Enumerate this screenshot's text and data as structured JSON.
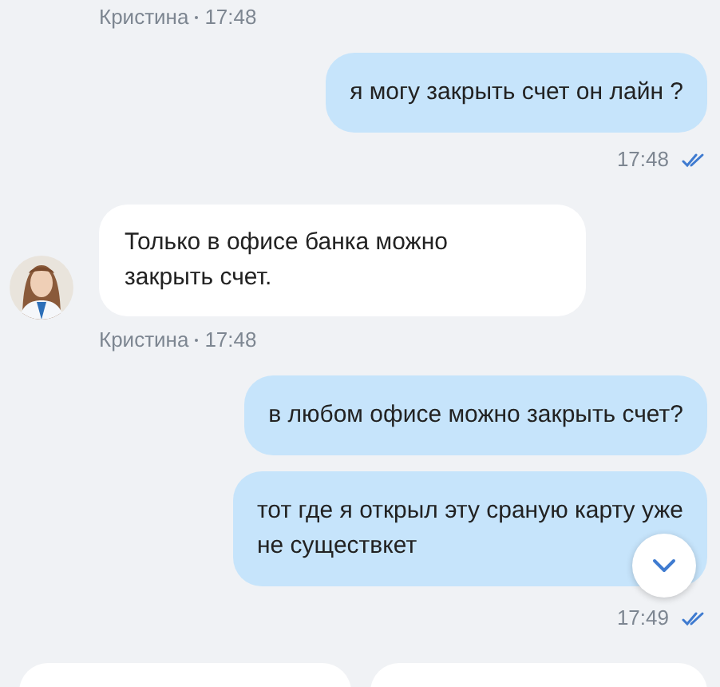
{
  "messages": [
    {
      "kind": "sender",
      "name": "Кристина",
      "time": "17:48"
    },
    {
      "kind": "outgoing",
      "lines": [
        "я могу закрыть счет он лайн ?"
      ]
    },
    {
      "kind": "time",
      "time": "17:48",
      "read": true
    },
    {
      "kind": "incoming",
      "lines": [
        "Только в офисе банка можно",
        "закрыть счет."
      ]
    },
    {
      "kind": "sender",
      "name": "Кристина",
      "time": "17:48"
    },
    {
      "kind": "outgoing",
      "lines": [
        "в любом офисе можно закрыть счет?"
      ]
    },
    {
      "kind": "outgoing",
      "lines": [
        "тот где я открыл эту сраную карту уже",
        "не существкет"
      ]
    },
    {
      "kind": "time",
      "time": "17:49",
      "read": true
    }
  ],
  "quick_replies": [
    {
      "kind": "chip"
    },
    {
      "kind": "chip"
    }
  ],
  "scroll_down_button": {
    "visible": true
  }
}
